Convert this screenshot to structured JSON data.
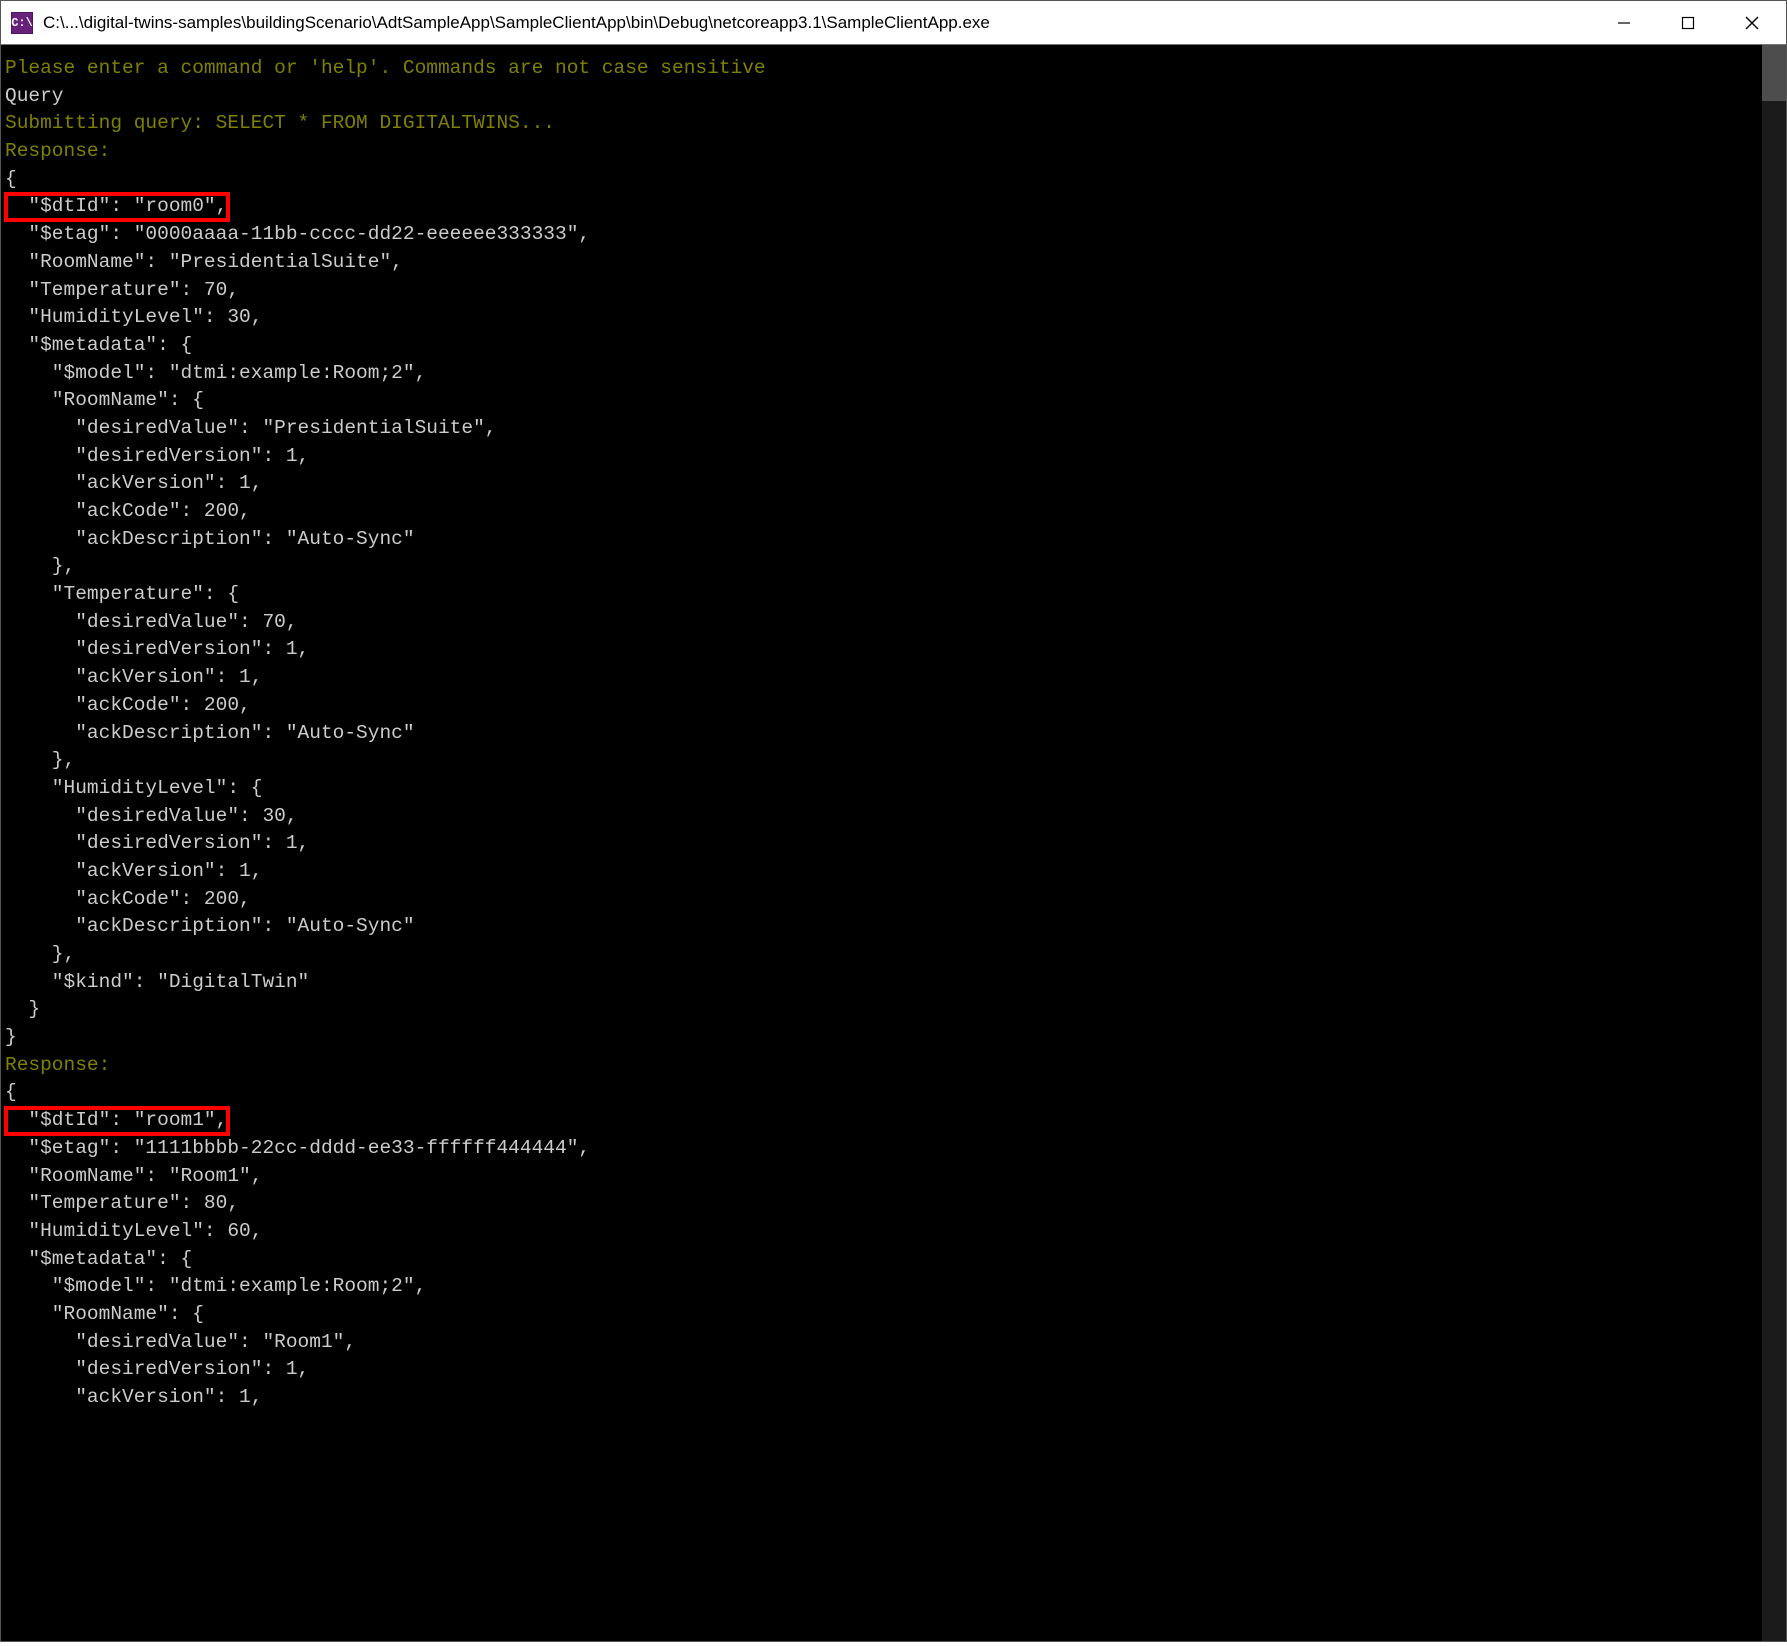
{
  "titlebar": {
    "icon_text": "C:\\",
    "path": "C:\\...\\digital-twins-samples\\buildingScenario\\AdtSampleApp\\SampleClientApp\\bin\\Debug\\netcoreapp3.1\\SampleClientApp.exe"
  },
  "console": {
    "prompt_line": "Please enter a command or 'help'. Commands are not case sensitive",
    "query_line": "Query",
    "submit_line": "Submitting query: SELECT * FROM DIGITALTWINS...",
    "response_label": "Response:",
    "open_brace": "{",
    "close_brace": "}",
    "entries": [
      {
        "dtid_line": "  \"$dtId\": \"room0\",",
        "lines_after": [
          "  \"$etag\": \"0000aaaa-11bb-cccc-dd22-eeeeee333333\",",
          "  \"RoomName\": \"PresidentialSuite\",",
          "  \"Temperature\": 70,",
          "  \"HumidityLevel\": 30,",
          "  \"$metadata\": {",
          "    \"$model\": \"dtmi:example:Room;2\",",
          "    \"RoomName\": {",
          "      \"desiredValue\": \"PresidentialSuite\",",
          "      \"desiredVersion\": 1,",
          "      \"ackVersion\": 1,",
          "      \"ackCode\": 200,",
          "      \"ackDescription\": \"Auto-Sync\"",
          "    },",
          "    \"Temperature\": {",
          "      \"desiredValue\": 70,",
          "      \"desiredVersion\": 1,",
          "      \"ackVersion\": 1,",
          "      \"ackCode\": 200,",
          "      \"ackDescription\": \"Auto-Sync\"",
          "    },",
          "    \"HumidityLevel\": {",
          "      \"desiredValue\": 30,",
          "      \"desiredVersion\": 1,",
          "      \"ackVersion\": 1,",
          "      \"ackCode\": 200,",
          "      \"ackDescription\": \"Auto-Sync\"",
          "    },",
          "    \"$kind\": \"DigitalTwin\"",
          "  }"
        ]
      },
      {
        "dtid_line": "  \"$dtId\": \"room1\",",
        "lines_after": [
          "  \"$etag\": \"1111bbbb-22cc-dddd-ee33-ffffff444444\",",
          "  \"RoomName\": \"Room1\",",
          "  \"Temperature\": 80,",
          "  \"HumidityLevel\": 60,",
          "  \"$metadata\": {",
          "    \"$model\": \"dtmi:example:Room;2\",",
          "    \"RoomName\": {",
          "      \"desiredValue\": \"Room1\",",
          "      \"desiredVersion\": 1,",
          "      \"ackVersion\": 1,"
        ]
      }
    ]
  }
}
